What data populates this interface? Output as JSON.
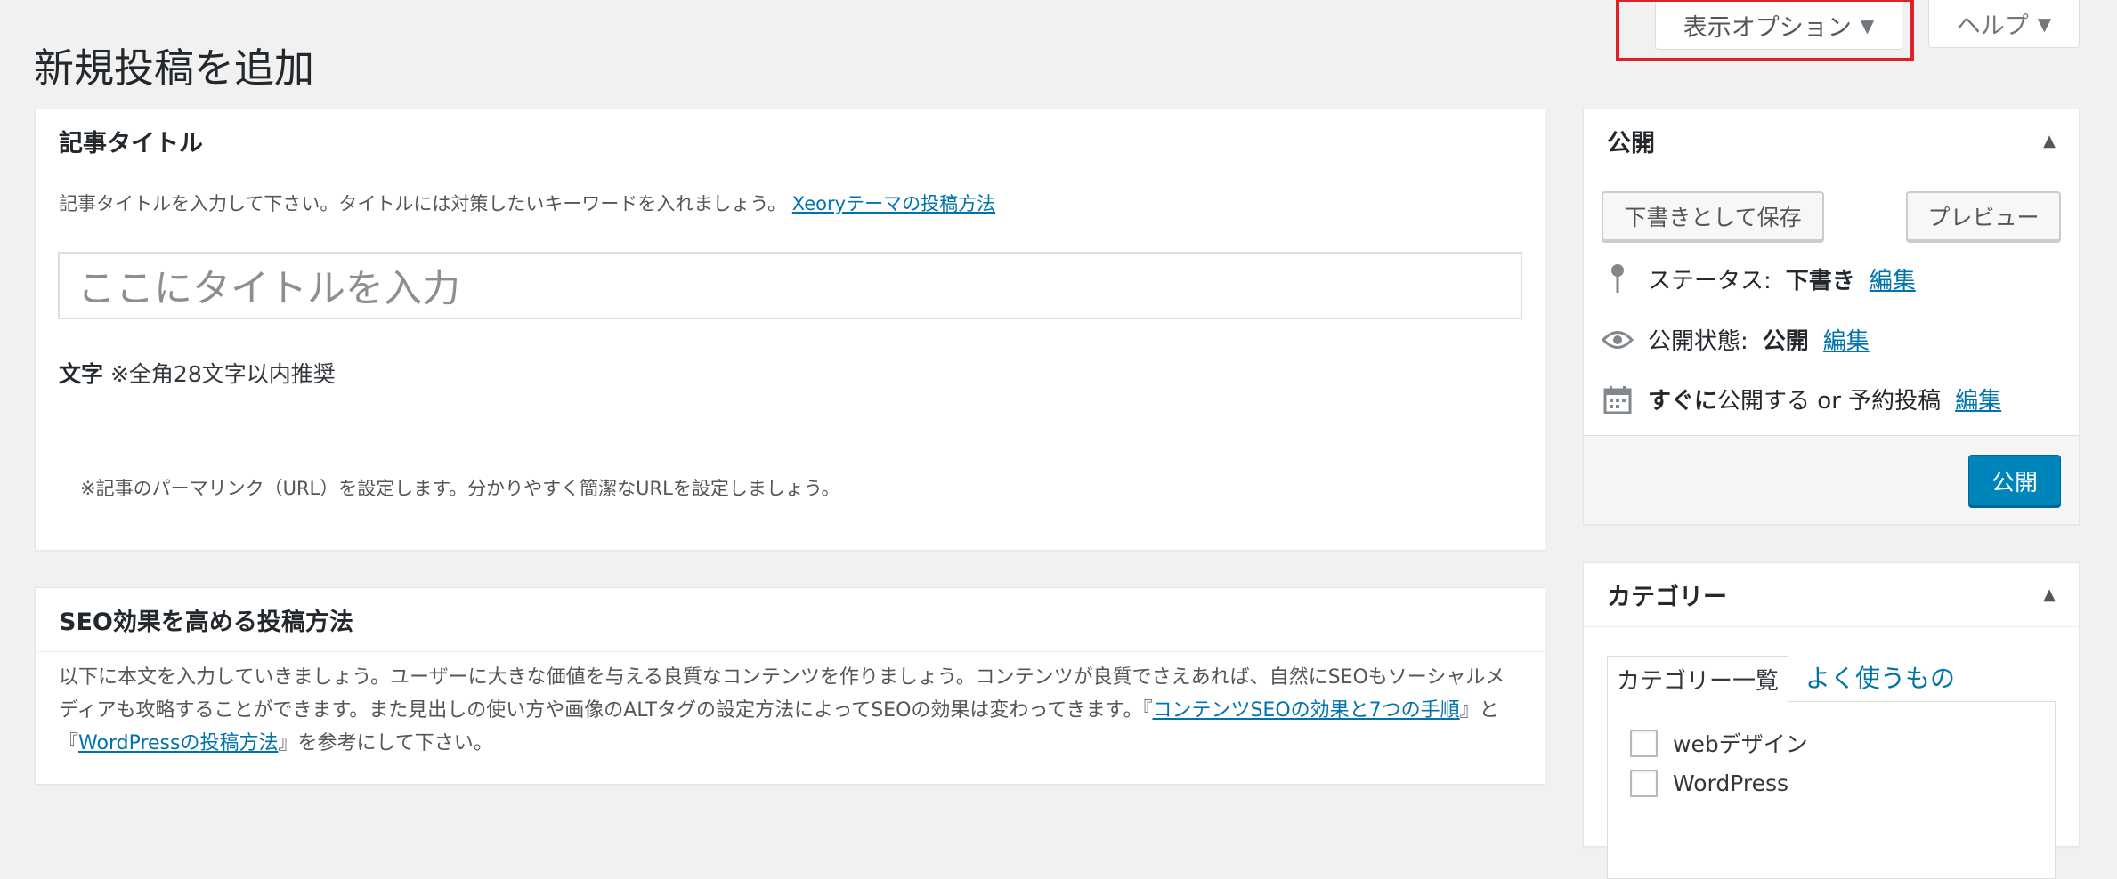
{
  "header": {
    "page_title": "新規投稿を追加",
    "screen_options_label": "表示オプション",
    "help_label": "ヘルプ"
  },
  "title_box": {
    "heading": "記事タイトル",
    "description": "記事タイトルを入力して下さい。タイトルには対策したいキーワードを入れましょう。",
    "link_text": "Xeoryテーマの投稿方法",
    "input_placeholder": "ここにタイトルを入力",
    "char_label": "文字",
    "char_note": "※全角28文字以内推奨",
    "permalink_note": "※記事のパーマリンク（URL）を設定します。分かりやすく簡潔なURLを設定しましょう。"
  },
  "seo_box": {
    "heading": "SEO効果を高める投稿方法",
    "text_part1": "以下に本文を入力していきましょう。ユーザーに大きな価値を与える良質なコンテンツを作りましょう。コンテンツが良質でさえあれば、自然にSEOもソーシャルメディアも攻略することができます。また見出しの使い方や画像のALTタグの設定方法によってSEOの効果は変わってきます。『",
    "link1": "コンテンツSEOの効果と7つの手順",
    "text_part2": "』と『",
    "link2": "WordPressの投稿方法",
    "text_part3": "』を参考にして下さい。"
  },
  "publish_box": {
    "heading": "公開",
    "save_draft_label": "下書きとして保存",
    "preview_label": "プレビュー",
    "status_label": "ステータス:",
    "status_value": "下書き",
    "visibility_label": "公開状態:",
    "visibility_value": "公開",
    "schedule_value": "すぐに",
    "schedule_text": "公開する or 予約投稿",
    "edit_label": "編集",
    "publish_label": "公開"
  },
  "category_box": {
    "heading": "カテゴリー",
    "tab_all": "カテゴリー一覧",
    "tab_popular": "よく使うもの",
    "items": [
      {
        "label": "webデザイン"
      },
      {
        "label": "WordPress"
      }
    ]
  },
  "colors": {
    "highlight_border": "#e01f26",
    "primary_button": "#0085ba",
    "link": "#0073aa"
  }
}
